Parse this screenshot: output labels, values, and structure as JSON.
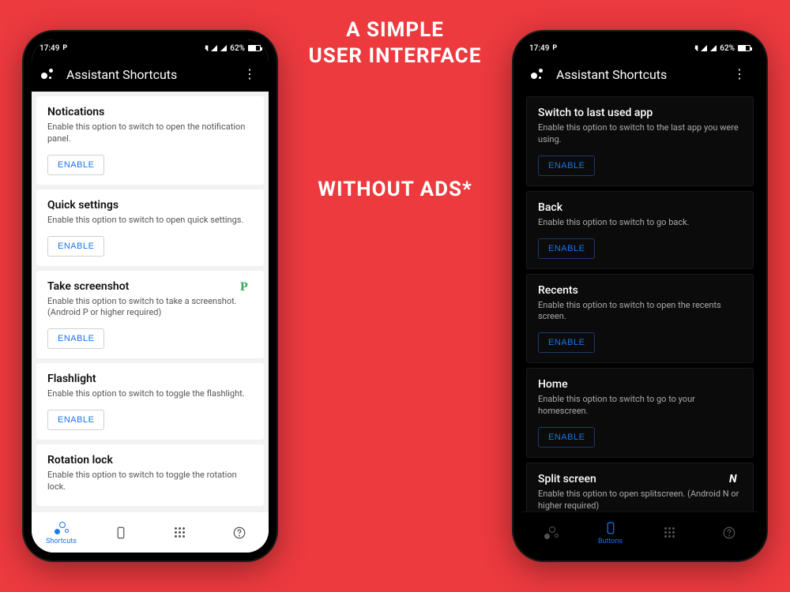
{
  "promo": {
    "line1": "A SIMPLE",
    "line2": "USER INTERFACE",
    "line3": "WITHOUT ADS*"
  },
  "status": {
    "time": "17:49",
    "battery": "62%"
  },
  "appbar": {
    "title": "Assistant Shortcuts"
  },
  "buttons": {
    "enable": "ENABLE"
  },
  "nav": {
    "shortcuts": "Shortcuts",
    "buttons": "Buttons"
  },
  "light_cards": [
    {
      "title": "Notications",
      "desc": "Enable this option to switch to open the notification panel."
    },
    {
      "title": "Quick settings",
      "desc": "Enable this option to switch to open quick settings."
    },
    {
      "title": "Take screenshot",
      "desc": "Enable this option to switch to take a screenshot. (Android P or higher required)",
      "badge": "P"
    },
    {
      "title": "Flashlight",
      "desc": "Enable this option to switch to toggle the flashlight."
    },
    {
      "title": "Rotation lock",
      "desc": "Enable this option to switch to toggle the rotation lock."
    }
  ],
  "dark_cards": [
    {
      "title": "Switch to last used app",
      "desc": "Enable this option to switch to the last app you were using."
    },
    {
      "title": "Back",
      "desc": "Enable this option to switch to go back."
    },
    {
      "title": "Recents",
      "desc": "Enable this option to switch to open the recents screen."
    },
    {
      "title": "Home",
      "desc": "Enable this option to switch to go to your homescreen."
    },
    {
      "title": "Split screen",
      "desc": "Enable this option to open splitscreen. (Android N or higher required)",
      "badge": "N"
    }
  ]
}
